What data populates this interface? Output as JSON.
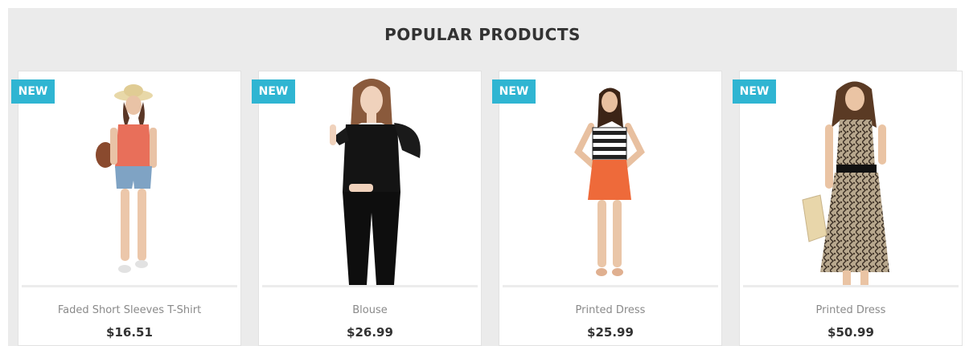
{
  "section": {
    "title": "POPULAR PRODUCTS"
  },
  "products": [
    {
      "badge": "NEW",
      "name": "Faded Short Sleeves T-Shirt",
      "price": "$16.51"
    },
    {
      "badge": "NEW",
      "name": "Blouse",
      "price": "$26.99"
    },
    {
      "badge": "NEW",
      "name": "Printed Dress",
      "price": "$25.99"
    },
    {
      "badge": "NEW",
      "name": "Printed Dress",
      "price": "$50.99"
    }
  ],
  "colors": {
    "badge": "#2fb5d2",
    "section_bg": "#ebebeb",
    "title_text": "#333333"
  }
}
